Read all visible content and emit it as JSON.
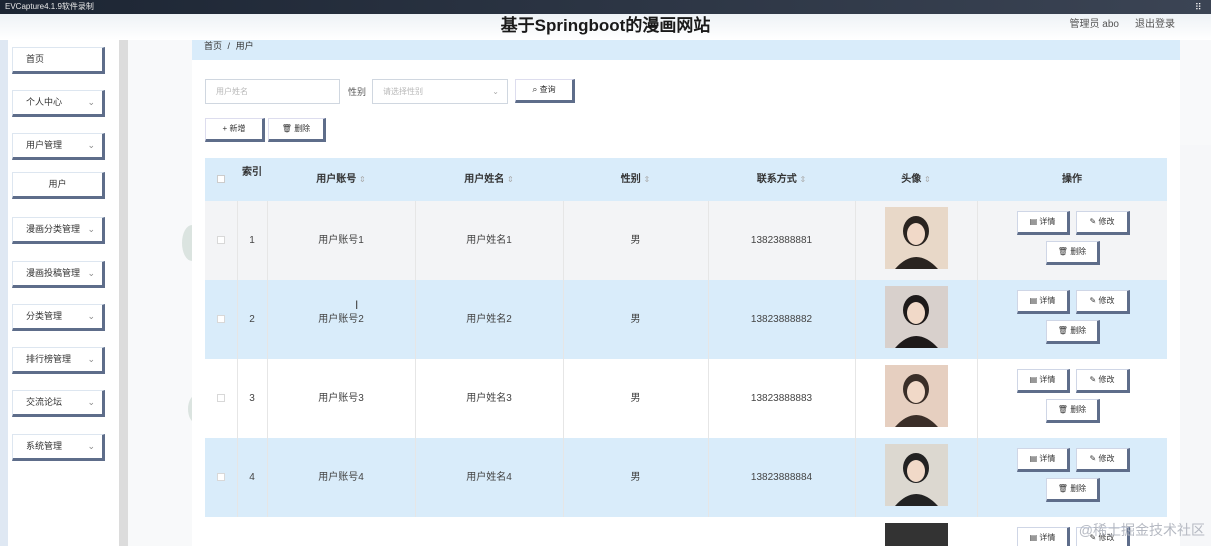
{
  "recorder": {
    "title": "EVCapture4.1.9软件录制"
  },
  "header": {
    "title": "基于Springboot的漫画网站",
    "admin": "管理员 abo",
    "logout": "退出登录"
  },
  "sidebar": {
    "items": [
      {
        "label": "首页",
        "chevron": false
      },
      {
        "label": "个人中心",
        "chevron": true
      },
      {
        "label": "用户管理",
        "chevron": true
      },
      {
        "label": "用户",
        "chevron": false,
        "sub": true
      },
      {
        "label": "漫画分类管理",
        "chevron": true
      },
      {
        "label": "漫画投稿管理",
        "chevron": true
      },
      {
        "label": "分类管理",
        "chevron": true
      },
      {
        "label": "排行榜管理",
        "chevron": true
      },
      {
        "label": "交流论坛",
        "chevron": true
      },
      {
        "label": "系统管理",
        "chevron": true
      }
    ]
  },
  "breadcrumb": {
    "home": "首页",
    "sep": "/",
    "current": "用户"
  },
  "search": {
    "name_placeholder": "用户姓名",
    "gender_label": "性别",
    "gender_placeholder": "请选择性别",
    "query_label": "查询"
  },
  "actions": {
    "add_label": "新增",
    "delete_label": "删除"
  },
  "table": {
    "headers": {
      "index": "索引",
      "account": "用户账号",
      "name": "用户姓名",
      "gender": "性别",
      "phone": "联系方式",
      "avatar": "头像",
      "ops": "操作"
    },
    "rows": [
      {
        "index": "1",
        "account": "用户账号1",
        "name": "用户姓名1",
        "gender": "男",
        "phone": "13823888881"
      },
      {
        "index": "2",
        "account": "用户账号2",
        "name": "用户姓名2",
        "gender": "男",
        "phone": "13823888882"
      },
      {
        "index": "3",
        "account": "用户账号3",
        "name": "用户姓名3",
        "gender": "男",
        "phone": "13823888883"
      },
      {
        "index": "4",
        "account": "用户账号4",
        "name": "用户姓名4",
        "gender": "男",
        "phone": "13823888884"
      }
    ],
    "row_buttons": {
      "detail": "详情",
      "edit": "修改",
      "delete": "删除"
    }
  },
  "watermark": "@稀土掘金技术社区",
  "colors": {
    "accent": "#5e6d8a",
    "header_bg": "#d9ecfa",
    "sidebar_bg": "#dfe8f3"
  }
}
